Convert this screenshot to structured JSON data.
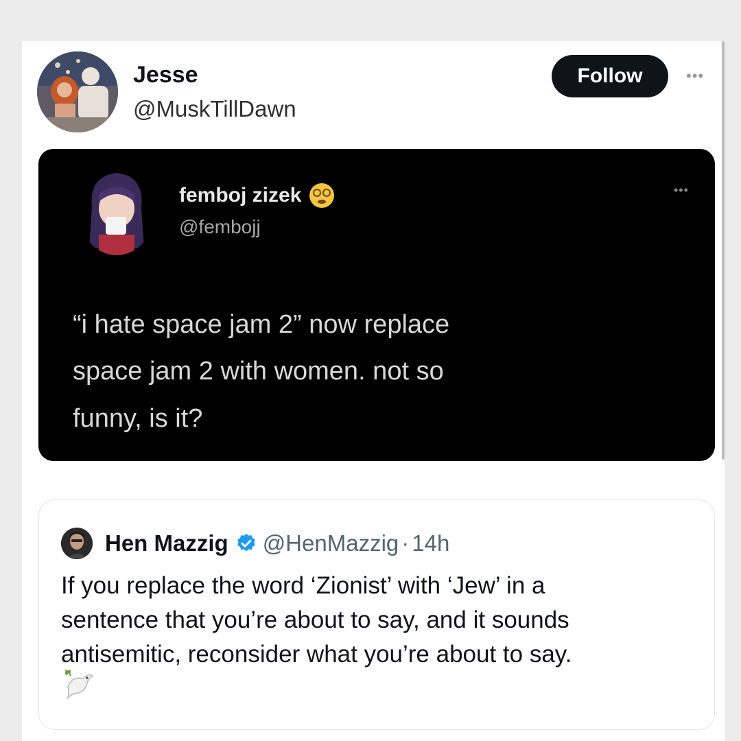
{
  "post": {
    "author_name": "Jesse",
    "author_handle": "@MuskTillDawn",
    "follow_label": "Follow",
    "more_icon": "more-horizontal-icon",
    "avatar_icon": "user-avatar-photo"
  },
  "embedded_screenshot": {
    "author_name": "femboj zizek",
    "author_handle": "@fembojj",
    "name_emoji": "dizzy-face-emoji",
    "avatar_icon": "anime-character-avatar",
    "more_icon": "more-horizontal-icon",
    "text": "“i hate space jam 2” now replace\nspace jam 2 with women. not so\nfunny, is it?"
  },
  "quoted_post": {
    "author_name": "Hen Mazzig",
    "verified_icon": "verified-badge-icon",
    "author_handle": "@HenMazzig",
    "separator": "·",
    "time": "14h",
    "text": "If you replace the word ‘Zionist’ with ‘Jew’ in a\nsentence that you’re about to say, and it sounds\nantisemitic, reconsider what you’re about to say.",
    "trailing_emoji": "dove-emoji"
  },
  "colors": {
    "follow_bg": "#0f1419",
    "verified": "#1d9bf0",
    "dark_card": "#000000",
    "secondary_text": "#536471"
  }
}
